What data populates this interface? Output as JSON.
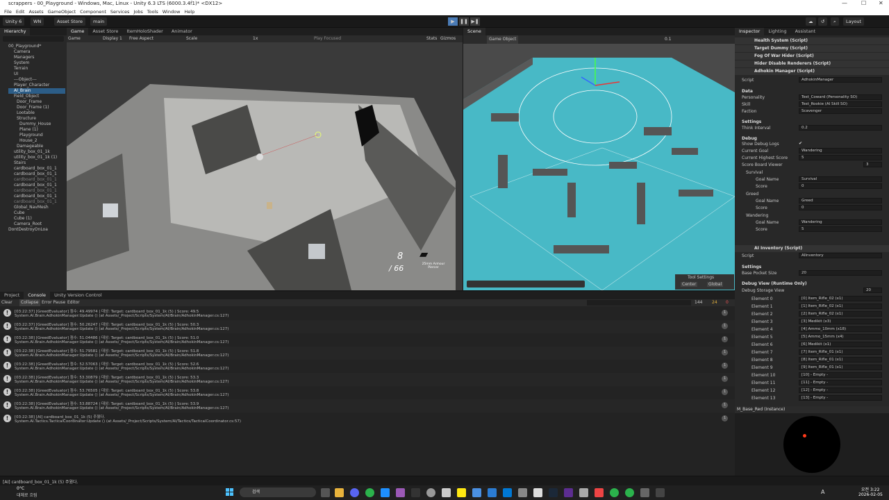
{
  "title": "scrappers - 00_Playground - Windows, Mac, Linux - Unity 6.3 LTS (6000.3.4f1)* <DX12>",
  "menu": [
    "File",
    "Edit",
    "Assets",
    "GameObject",
    "Component",
    "Services",
    "Jobs",
    "Tools",
    "Window",
    "Help"
  ],
  "toolbar": {
    "account": "Unity 6",
    "wn": "WN",
    "store": "Asset Store",
    "branch": "main",
    "layout": "Layout"
  },
  "hierarchy": {
    "tab": "Hierarchy",
    "items": [
      {
        "label": "00_Playground*",
        "indent": 0
      },
      {
        "label": "Camera",
        "indent": 2
      },
      {
        "label": "Managers",
        "indent": 2
      },
      {
        "label": "System",
        "indent": 2
      },
      {
        "label": "Terrain",
        "indent": 2
      },
      {
        "label": "UI",
        "indent": 2
      },
      {
        "label": "---Object---",
        "indent": 2
      },
      {
        "label": "Player_Character",
        "indent": 2
      },
      {
        "label": "AI_Brain",
        "indent": 2,
        "sel": true
      },
      {
        "label": "Field_Object",
        "indent": 2
      },
      {
        "label": "Door_Frame",
        "indent": 3
      },
      {
        "label": "Door_Frame (1)",
        "indent": 3
      },
      {
        "label": "Lootable",
        "indent": 3
      },
      {
        "label": "Structure",
        "indent": 3
      },
      {
        "label": "Dummy_House",
        "indent": 4
      },
      {
        "label": "Plane (1)",
        "indent": 4
      },
      {
        "label": "Playground",
        "indent": 4
      },
      {
        "label": "House_2",
        "indent": 4
      },
      {
        "label": "Damageable",
        "indent": 3
      },
      {
        "label": "utility_box_01_1k",
        "indent": 2
      },
      {
        "label": "utility_box_01_1k (1)",
        "indent": 2
      },
      {
        "label": "Stairs",
        "indent": 2
      },
      {
        "label": "cardboard_box_01_1",
        "indent": 2
      },
      {
        "label": "cardboard_box_01_1",
        "indent": 2
      },
      {
        "label": "cardboard_box_01_1",
        "indent": 2,
        "dim": true
      },
      {
        "label": "cardboard_box_01_1",
        "indent": 2
      },
      {
        "label": "cardboard_box_01_1",
        "indent": 2,
        "dim": true
      },
      {
        "label": "cardboard_box_01_1",
        "indent": 2
      },
      {
        "label": "cardboard_box_01_1",
        "indent": 2,
        "dim": true
      },
      {
        "label": "Global_NavMesh",
        "indent": 2
      },
      {
        "label": "Cube",
        "indent": 2
      },
      {
        "label": "Cube (1)",
        "indent": 2
      },
      {
        "label": "Camera_Root",
        "indent": 2
      },
      {
        "label": "DontDestroyOnLoa",
        "indent": 0
      }
    ]
  },
  "game": {
    "tabs": [
      "Game",
      "Asset Store",
      "ItemHoloShader",
      "Animator"
    ],
    "display": "Display 1",
    "aspect": "Free Aspect",
    "scale": "Scale",
    "scale_val": "1x",
    "play": "Play Focused",
    "stats": "Stats",
    "gizmos": "Gizmos",
    "ammo": "8",
    "ammo_total": "/ 66",
    "weapon": "25mm Armour Piercer"
  },
  "scene": {
    "tab": "Scene",
    "view": "Game Object",
    "zoom": "0.1",
    "tool_settings": "Tool Settings",
    "center": "Center",
    "global": "Global"
  },
  "inspector": {
    "tabs": [
      "Inspector",
      "Lighting",
      "Assistant"
    ],
    "components": [
      "Health System (Script)",
      "Target Dummy (Script)",
      "Fog Of War Hider (Script)",
      "Hider Disable Renderers (Script)",
      "Adhokin Manager (Script)"
    ],
    "script_label": "Script",
    "script_val": "AdhokinManager",
    "data": "Data",
    "personality": "Personality",
    "personality_val": "Test_Coward (Personality SO)",
    "skill": "Skill",
    "skill_val": "Test_Rookie (AI Skill SO)",
    "faction": "Faction",
    "faction_val": "Scavenger",
    "settings": "Settings",
    "think": "Think Interval",
    "think_val": "0.2",
    "debug": "Debug",
    "show_debug": "Show Debug Logs",
    "current_goal": "Current Goal",
    "current_goal_val": "Wandering",
    "highest": "Current Highest Score",
    "highest_val": "5",
    "viewer": "Score Board Viewer",
    "viewer_val": "3",
    "goals": [
      {
        "head": "Survival",
        "name": "Goal Name",
        "val": "Survival",
        "score": "Score",
        "sval": "0"
      },
      {
        "head": "Greed",
        "name": "Goal Name",
        "val": "Greed",
        "score": "Score",
        "sval": "0"
      },
      {
        "head": "Wandering",
        "name": "Goal Name",
        "val": "Wandering",
        "score": "Score",
        "sval": "5"
      }
    ],
    "inv_title": "AI Inventory (Script)",
    "inv_script": "AIInventory",
    "base_pocket": "Base Pocket Size",
    "base_pocket_val": "20",
    "debug_view": "Debug View (Runtime Only)",
    "storage": "Debug Storage View",
    "storage_val": "20",
    "elements": [
      [
        "Element 0",
        "[0] Item_Rifle_02 (x1)"
      ],
      [
        "Element 1",
        "[1] Item_Rifle_02 (x1)"
      ],
      [
        "Element 2",
        "[2] Item_Rifle_02 (x1)"
      ],
      [
        "Element 3",
        "[3] Medikit (x3)"
      ],
      [
        "Element 4",
        "[4] Ammo_10mm (x18)"
      ],
      [
        "Element 5",
        "[5] Ammo_15mm (x4)"
      ],
      [
        "Element 6",
        "[6] Medikit (x1)"
      ],
      [
        "Element 7",
        "[7] Item_Rifle_01 (x1)"
      ],
      [
        "Element 8",
        "[8] Item_Rifle_01 (x1)"
      ],
      [
        "Element 9",
        "[9] Item_Rifle_01 (x1)"
      ],
      [
        "Element 10",
        "[10] - Empty -"
      ],
      [
        "Element 11",
        "[11] - Empty -"
      ],
      [
        "Element 12",
        "[12] - Empty -"
      ],
      [
        "Element 13",
        "[13] - Empty -"
      ]
    ],
    "material": "M_Base_Red (Instance)"
  },
  "console": {
    "tabs": [
      "Project",
      "Console",
      "Unity Version Control"
    ],
    "clear": "Clear",
    "collapse": "Collapse",
    "error_pause": "Error Pause",
    "editor": "Editor",
    "counts": [
      "144",
      "24",
      "0"
    ],
    "logs": [
      [
        "[03:22:37] [GreedEvaluator] 점수: 49.49974 | 대상: Target: cardboard_box_01_1k (5) | Score: 49.5",
        "System.AI.Brain.AdhokinManager:Update () (at Assets/_Project/Scripts/System/AI/Brain/AdhokinManager.cs:127)"
      ],
      [
        "[03:22:37] [GreedEvaluator] 점수: 50.26247 | 대상: Target: cardboard_box_01_1k (5) | Score: 50.3",
        "System.AI.Brain.AdhokinManager:Update () (at Assets/_Project/Scripts/System/AI/Brain/AdhokinManager.cs:127)"
      ],
      [
        "[03:22:38] [GreedEvaluator] 점수: 51.04486 | 대상: Target: cardboard_box_01_1k (5) | Score: 51.0",
        "System.AI.Brain.AdhokinManager:Update () (at Assets/_Project/Scripts/System/AI/Brain/AdhokinManager.cs:127)"
      ],
      [
        "[03:22:38] [GreedEvaluator] 점수: 51.79581 | 대상: Target: cardboard_box_01_1k (5) | Score: 51.8",
        "System.AI.Brain.AdhokinManager:Update () (at Assets/_Project/Scripts/System/AI/Brain/AdhokinManager.cs:127)"
      ],
      [
        "[03:22:38] [GreedEvaluator] 점수: 52.57063 | 대상: Target: cardboard_box_01_1k (5) | Score: 52.6",
        "System.AI.Brain.AdhokinManager:Update () (at Assets/_Project/Scripts/System/AI/Brain/AdhokinManager.cs:127)"
      ],
      [
        "[03:22:38] [GreedEvaluator] 점수: 53.30879 | 대상: Target: cardboard_box_01_1k (5) | Score: 53.3",
        "System.AI.Brain.AdhokinManager:Update () (at Assets/_Project/Scripts/System/AI/Brain/AdhokinManager.cs:127)"
      ],
      [
        "[03:22:38] [GreedEvaluator] 점수: 53.76505 | 대상: Target: cardboard_box_01_1k (5) | Score: 53.8",
        "System.AI.Brain.AdhokinManager:Update () (at Assets/_Project/Scripts/System/AI/Brain/AdhokinManager.cs:127)"
      ],
      [
        "[03:22:38] [GreedEvaluator] 점수: 53.88724 | 대상: Target: cardboard_box_01_1k (5) | Score: 53.9",
        "System.AI.Brain.AdhokinManager:Update () (at Assets/_Project/Scripts/System/AI/Brain/AdhokinManager.cs:127)"
      ],
      [
        "[03:22:38] [AI] cardboard_box_01_1k (5) 주웠다.",
        "System.AI.Tactics.TacticalCoordinator:Update () (at Assets/_Project/Scripts/System/AI/Tactics/TacticalCoordinator.cs:57)"
      ]
    ]
  },
  "status_text": "[AI] cardboard_box_01_1k (5) 주웠다.",
  "taskbar": {
    "weather": "0°C",
    "weather2": "대체로 흐림",
    "search": "검색",
    "lang": "A",
    "time": "오전 3:22",
    "date": "2026-02-05"
  }
}
